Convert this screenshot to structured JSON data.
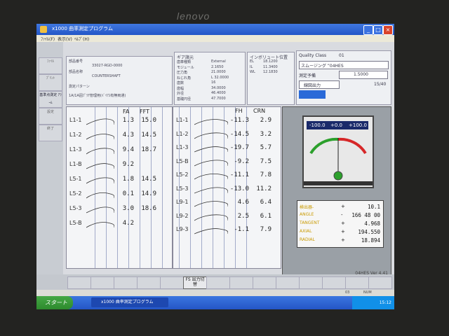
{
  "monitor": {
    "brand": "lenovo"
  },
  "window": {
    "title": "x1000 曲率測定プログラム",
    "menu": [
      "ﾌｧｲﾙ(F)",
      "表示(V)",
      "ﾍﾙﾌﾟ(H)"
    ]
  },
  "info": {
    "part_label": "部品番号",
    "part_value": "33027-RGD-0000",
    "name_label": "部品名称",
    "name_value": "COUNTERSHAFT",
    "pattern_label": "測定パターン",
    "pattern_value": "1A/1A固ﾌﾟﾗﾁ管理用(ﾊﾞｲｱｽ有無両通)"
  },
  "gear": {
    "title": "ギア諸元",
    "rows": [
      {
        "label": "歯車種類",
        "value": "External"
      },
      {
        "label": "モジュール",
        "value": "2.1650"
      },
      {
        "label": "圧力角",
        "value": "21.0000"
      },
      {
        "label": "ねじれ角",
        "value": "L 32.0000"
      },
      {
        "label": "歯数",
        "value": "16"
      },
      {
        "label": "歯幅",
        "value": "34.0000"
      },
      {
        "label": "外径",
        "value": "46.4000"
      },
      {
        "label": "基礎円径",
        "value": "47.7000"
      }
    ]
  },
  "involute": {
    "title": "インボリュート位置",
    "rows": [
      {
        "label": "EL",
        "value": "18.1200"
      },
      {
        "label": "IL",
        "value": "11.3400"
      },
      {
        "label": "WL",
        "value": "12.1830"
      }
    ]
  },
  "quality": {
    "class_label": "Quality Class",
    "class_value": "01",
    "smoothing": "スムージング  ”04HES",
    "measure_label": "測定予備",
    "measure_value": "1.5000",
    "chart_button": "線図出力",
    "page": "15/40"
  },
  "left_buttons": [
    "ﾌｧｲﾙ",
    "ﾌﾟﾘﾝﾄ",
    "基準点測定 ｱﾗｰﾑ",
    "設定",
    "終了"
  ],
  "table": {
    "left_headers": [
      "FA",
      "FFT"
    ],
    "right_headers": [
      "FH",
      "CRN"
    ],
    "left_rows": [
      {
        "label": "L1-1",
        "fa": "1.3",
        "fft": "15.0"
      },
      {
        "label": "L1-2",
        "fa": "4.3",
        "fft": "14.5"
      },
      {
        "label": "L1-3",
        "fa": "9.4",
        "fft": "18.7"
      },
      {
        "label": "L1-B",
        "fa": "9.2",
        "fft": ""
      },
      {
        "label": "L5-1",
        "fa": "1.8",
        "fft": "14.5"
      },
      {
        "label": "L5-2",
        "fa": "0.1",
        "fft": "14.9"
      },
      {
        "label": "L5-3",
        "fa": "3.0",
        "fft": "18.6"
      },
      {
        "label": "L5-B",
        "fa": "4.2",
        "fft": ""
      }
    ],
    "right_rows": [
      {
        "label": "L1-1",
        "fh": "-11.3",
        "crn": "2.9"
      },
      {
        "label": "L1-2",
        "fh": "-14.5",
        "crn": "3.2"
      },
      {
        "label": "L1-3",
        "fh": "-19.7",
        "crn": "5.7"
      },
      {
        "label": "L5-B",
        "fh": "-9.2",
        "crn": "7.5"
      },
      {
        "label": "L5-2",
        "fh": "-11.1",
        "crn": "7.8"
      },
      {
        "label": "L5-3",
        "fh": "-13.0",
        "crn": "11.2"
      },
      {
        "label": "L9-1",
        "fh": "4.6",
        "crn": "6.4"
      },
      {
        "label": "L9-2",
        "fh": "2.5",
        "crn": "6.1"
      },
      {
        "label": "L9-3",
        "fh": "-1.1",
        "crn": "7.9"
      }
    ]
  },
  "gauge": {
    "scale": [
      "-100.0",
      "+0.0",
      "+100.0"
    ],
    "needle_value": 0.1,
    "range_min": -100,
    "range_max": 100
  },
  "readout": {
    "rows": [
      {
        "label": "検出器-",
        "sign": "+",
        "value": "10.1"
      },
      {
        "label": "ANGLE",
        "sign": "-",
        "value": "166 48 00"
      },
      {
        "label": "TANGENT",
        "sign": "+",
        "value": "4.968"
      },
      {
        "label": "AXIAL",
        "sign": "+",
        "value": "194.550"
      },
      {
        "label": "RADIAL",
        "sign": "+",
        "value": "18.894"
      }
    ]
  },
  "version": "04HES Ver 4.41",
  "bottom_buttons": [
    "",
    "",
    "",
    "",
    "",
    "FS 出力切替",
    "",
    "",
    "",
    "",
    "",
    "",
    "",
    ""
  ],
  "status": {
    "left": "",
    "right1": "03",
    "right2": "NUM"
  },
  "taskbar": {
    "start": "スタート",
    "task": "x1000 曲率測定プログラム",
    "clock": "15:12"
  },
  "colors": {
    "accent": "#2457c7",
    "gauge_green": "#2ca02c",
    "gauge_red": "#d62728",
    "label_yellow": "#c99a00"
  }
}
